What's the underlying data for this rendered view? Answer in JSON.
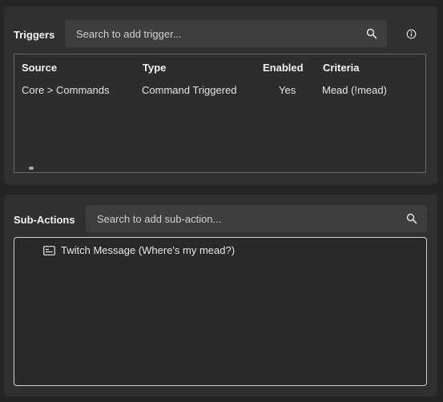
{
  "triggers": {
    "title": "Triggers",
    "search_placeholder": "Search to add trigger...",
    "info_icon": "info-icon",
    "columns": [
      "Source",
      "Type",
      "Enabled",
      "Criteria"
    ],
    "rows": [
      {
        "source": "Core > Commands",
        "type": "Command Triggered",
        "enabled": "Yes",
        "criteria": "Mead (!mead)"
      }
    ]
  },
  "sub_actions": {
    "title": "Sub-Actions",
    "search_placeholder": "Search to add sub-action...",
    "items": [
      {
        "label": "Twitch Message (Where's my mead?)",
        "icon": "message-box-icon"
      }
    ]
  },
  "colors": {
    "background": "#262426",
    "panel": "#322f32",
    "search": "#403d40"
  }
}
